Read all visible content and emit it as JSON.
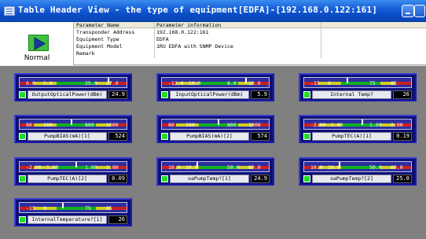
{
  "window": {
    "title": "Table Header View  - the type of equipment[EDFA]-[192.168.0.122:161]",
    "icon": "table-icon"
  },
  "device": {
    "status_label": "Normal",
    "status_icon": "play-arrow-icon",
    "status_color": "#3fbf3f"
  },
  "params": {
    "header_name": "Parameter Name",
    "header_value": "Parameter information",
    "rows": [
      {
        "name": "Transponder Address",
        "value": "192.168.0.122:161"
      },
      {
        "name": "Equipment Type",
        "value": "EDFA"
      },
      {
        "name": "Equipment Model",
        "value": "1RU EDFA with SNMP Device"
      },
      {
        "name": "Remark",
        "value": ""
      }
    ]
  },
  "colors": {
    "gauge_bg": "#0b0f75",
    "scale_red": "#c82020",
    "scale_yellow": "#d0d020",
    "scale_green": "#10b020",
    "led_ok": "#22dd22"
  },
  "gauges": [
    {
      "label": "OutputOpticalPower(dBm)",
      "value": "24.9",
      "ticks": [
        "0.0",
        "2.0",
        "25.0",
        "27.0"
      ],
      "level": 0.82
    },
    {
      "label": "InputOpticalPower(dBm)",
      "value": "5.9",
      "ticks": [
        "-12.0",
        "-10.0",
        "8.0",
        "10.0"
      ],
      "level": 0.78
    },
    {
      "label": "Internal Temp?",
      "value": "26",
      "ticks": [
        "-15",
        "0",
        "75",
        "85"
      ],
      "level": 0.4
    },
    {
      "label": "PumpBIAS(mA)[1]",
      "value": "524",
      "ticks": [
        "80",
        "100",
        "800",
        "1000"
      ],
      "level": 0.48
    },
    {
      "label": "PumpBIAS(mA)[2]",
      "value": "574",
      "ticks": [
        "80",
        "100",
        "800",
        "1000"
      ],
      "level": 0.52
    },
    {
      "label": "PumpTEC(A)[1]",
      "value": "0.19",
      "ticks": [
        "-2.00",
        "-1.60",
        "1.60",
        "2.00"
      ],
      "level": 0.54
    },
    {
      "label": "PumpTEC(A)[2]",
      "value": "0.09",
      "ticks": [
        "-2.00",
        "-1.60",
        "1.60",
        "2.00"
      ],
      "level": 0.52
    },
    {
      "label": "oaPumpTemp?[1]",
      "value": "24.9",
      "ticks": [
        "10.0",
        "20.0",
        "50.0",
        "60.0"
      ],
      "level": 0.32
    },
    {
      "label": "oaPumpTemp?[2]",
      "value": "25.0",
      "ticks": [
        "10.0",
        "20.0",
        "50.0",
        "60.0"
      ],
      "level": 0.32
    },
    {
      "label": "InternalTemperature?[1]",
      "value": "26",
      "ticks": [
        "-15",
        "0",
        "75",
        "85"
      ],
      "level": 0.4
    }
  ]
}
